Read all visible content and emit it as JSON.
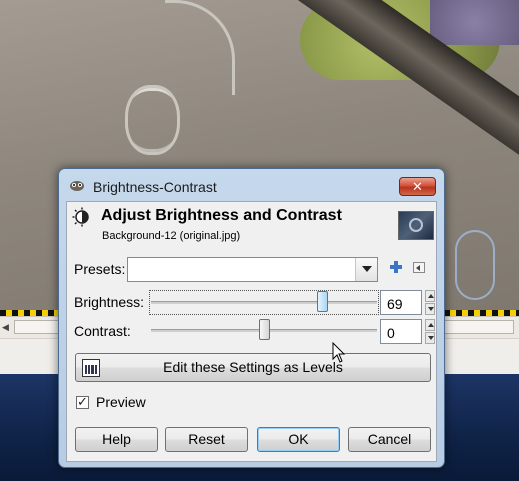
{
  "dialog": {
    "window_title": "Brightness-Contrast",
    "close_glyph": "✕",
    "header_title": "Adjust Brightness and Contrast",
    "header_subtitle": "Background-12 (original.jpg)",
    "presets": {
      "label": "Presets:",
      "value": ""
    },
    "brightness": {
      "label": "Brightness:",
      "value": "69",
      "min": -127,
      "max": 127
    },
    "contrast": {
      "label": "Contrast:",
      "value": "0",
      "min": -127,
      "max": 127
    },
    "levels_button": "Edit these Settings as Levels",
    "preview": {
      "label": "Preview",
      "checked": true,
      "check_glyph": "✓"
    },
    "buttons": {
      "help": "Help",
      "reset": "Reset",
      "ok": "OK",
      "cancel": "Cancel"
    }
  },
  "icons": [
    "gimp-app-icon",
    "brightness-contrast-icon",
    "image-thumbnail-icon",
    "chevron-down-icon",
    "plus-icon",
    "menu-arrow-icon",
    "levels-histogram-icon",
    "mouse-pointer-icon"
  ]
}
